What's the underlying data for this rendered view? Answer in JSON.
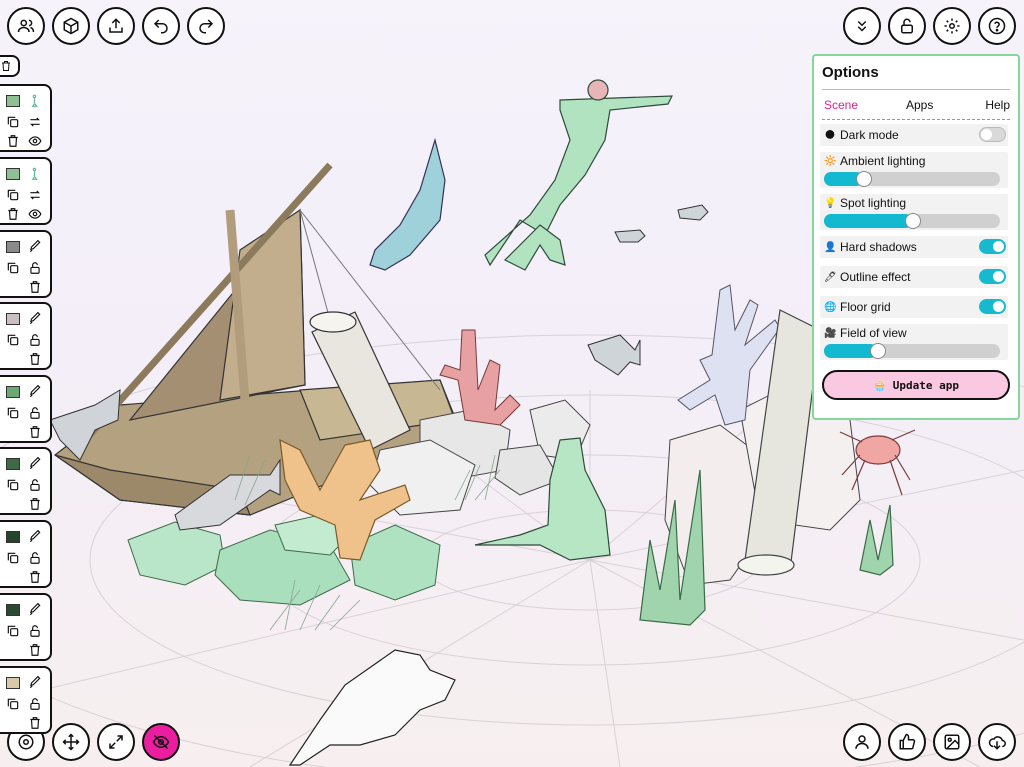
{
  "toolbar": {
    "top_left": [
      {
        "name": "collaborators-button",
        "icon": "users-icon"
      },
      {
        "name": "add-object-button",
        "icon": "cube-icon"
      },
      {
        "name": "share-button",
        "icon": "upload-icon"
      },
      {
        "name": "undo-button",
        "icon": "undo-icon"
      },
      {
        "name": "redo-button",
        "icon": "redo-icon"
      }
    ],
    "top_right": [
      {
        "name": "collapse-button",
        "icon": "chevron-double-down-icon"
      },
      {
        "name": "lock-button",
        "icon": "unlock-icon"
      },
      {
        "name": "settings-button",
        "icon": "gear-icon"
      },
      {
        "name": "help-button",
        "icon": "question-icon"
      }
    ],
    "bottom_left": [
      {
        "name": "focus-button",
        "icon": "target-icon"
      },
      {
        "name": "move-button",
        "icon": "move-arrows-icon"
      },
      {
        "name": "expand-button",
        "icon": "expand-icon"
      },
      {
        "name": "hide-button",
        "icon": "eye-off-icon",
        "accent": "#ec1ea0"
      }
    ],
    "bottom_right": [
      {
        "name": "profile-button",
        "icon": "user-icon"
      },
      {
        "name": "like-button",
        "icon": "thumbs-up-icon"
      },
      {
        "name": "snapshot-button",
        "icon": "image-icon"
      },
      {
        "name": "download-button",
        "icon": "download-icon"
      }
    ]
  },
  "layers": [
    {
      "swatch": "#8fbf94",
      "type": "mermaid"
    },
    {
      "swatch": "#8fbf94",
      "type": "mermaid"
    },
    {
      "swatch": "#8a8a8a",
      "type": "brush"
    },
    {
      "swatch": "#c9bfc4",
      "type": "brush"
    },
    {
      "swatch": "#6aa874",
      "type": "brush"
    },
    {
      "swatch": "#3f6a46",
      "type": "brush"
    },
    {
      "swatch": "#24452c",
      "type": "brush"
    },
    {
      "swatch": "#2a4a30",
      "type": "brush"
    },
    {
      "swatch": "#d9c9ab",
      "type": "brush"
    }
  ],
  "options": {
    "title": "Options",
    "tabs": [
      {
        "label": "Scene",
        "active": true
      },
      {
        "label": "Apps",
        "active": false
      },
      {
        "label": "Help",
        "active": false
      }
    ],
    "dark_mode": {
      "label": "Dark mode",
      "emoji": "🌑",
      "on": false
    },
    "ambient": {
      "label": "Ambient lighting",
      "emoji": "🔆",
      "value": 0.18
    },
    "spot": {
      "label": "Spot lighting",
      "emoji": "💡",
      "value": 0.46
    },
    "hard_shadows": {
      "label": "Hard shadows",
      "emoji": "👤",
      "on": true
    },
    "outline": {
      "label": "Outline effect",
      "emoji": "🖊",
      "on": true
    },
    "floor_grid": {
      "label": "Floor grid",
      "emoji": "🌐",
      "on": true
    },
    "fov": {
      "label": "Field of view",
      "emoji": "🎥",
      "value": 0.26
    },
    "update": {
      "label": "Update app",
      "emoji": "🧁"
    }
  },
  "colors": {
    "accent_pink": "#ec1ea0",
    "tab_active": "#e0208e",
    "toggle_on": "#17b9cf",
    "panel_border": "#86d59a",
    "update_bg": "#fbc8e2"
  }
}
